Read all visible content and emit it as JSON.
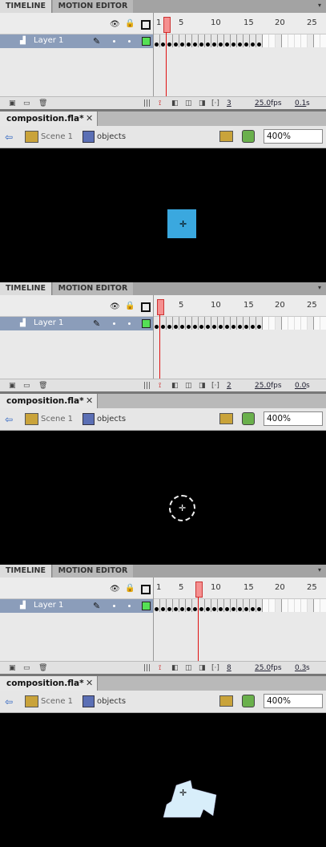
{
  "panels": [
    {
      "tabs": {
        "active": "TIMELINE",
        "inactive": "MOTION EDITOR"
      },
      "ruler": [
        "1",
        "5",
        "10",
        "15",
        "20",
        "25"
      ],
      "layer": {
        "name": "Layer 1"
      },
      "footer": {
        "frame": "3",
        "fps": "25.0",
        "fps_unit": "fps",
        "time": "0.1",
        "time_unit": "s"
      },
      "document": {
        "name": "composition.fla*"
      },
      "breadcrumb": {
        "scene": "Scene 1",
        "symbol": "objects"
      },
      "zoom": "400%",
      "shape": "square",
      "current_frame": 3
    },
    {
      "tabs": {
        "active": "TIMELINE",
        "inactive": "MOTION EDITOR"
      },
      "ruler": [
        "1",
        "5",
        "10",
        "15",
        "20",
        "25"
      ],
      "layer": {
        "name": "Layer 1"
      },
      "footer": {
        "frame": "2",
        "fps": "25.0",
        "fps_unit": "fps",
        "time": "0.0",
        "time_unit": "s"
      },
      "document": {
        "name": "composition.fla*"
      },
      "breadcrumb": {
        "scene": "Scene 1",
        "symbol": "objects"
      },
      "zoom": "400%",
      "shape": "circle",
      "current_frame": 2
    },
    {
      "tabs": {
        "active": "TIMELINE",
        "inactive": "MOTION EDITOR"
      },
      "ruler": [
        "1",
        "5",
        "10",
        "15",
        "20",
        "25"
      ],
      "layer": {
        "name": "Layer 1"
      },
      "footer": {
        "frame": "8",
        "fps": "25.0",
        "fps_unit": "fps",
        "time": "0.3",
        "time_unit": "s"
      },
      "document": {
        "name": "composition.fla*"
      },
      "breadcrumb": {
        "scene": "Scene 1",
        "symbol": "objects"
      },
      "zoom": "400%",
      "shape": "polygon",
      "current_frame": 8
    }
  ],
  "colors": {
    "square": "#3aa8df",
    "polygon": "#d8eefa",
    "stage": "#000000",
    "layer_row": "#8b9dba"
  },
  "keyframe_count": 17
}
